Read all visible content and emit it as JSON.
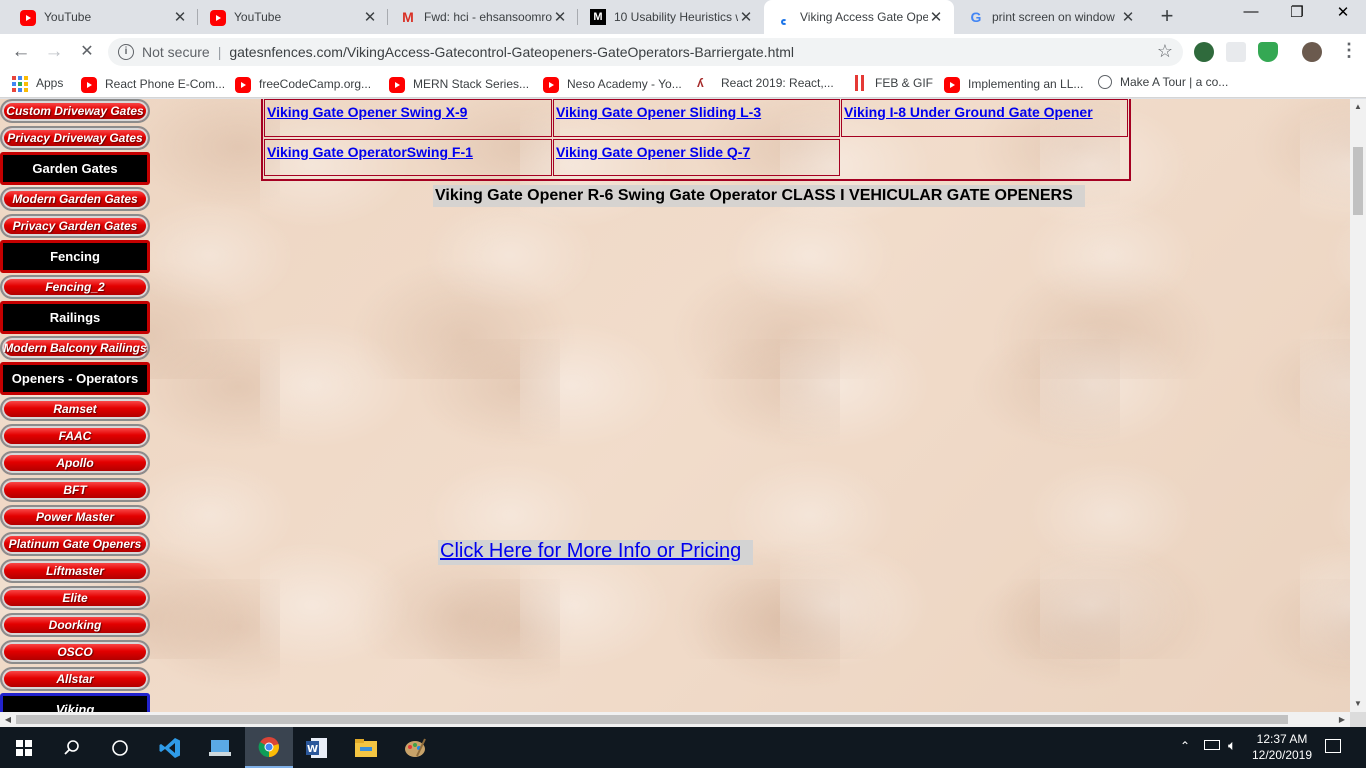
{
  "browser": {
    "tabs": [
      {
        "title": "YouTube",
        "icon": "youtube-icon",
        "active": false
      },
      {
        "title": "YouTube",
        "icon": "youtube-icon",
        "active": false
      },
      {
        "title": "Fwd: hci - ehsansoomro",
        "icon": "gmail-icon",
        "active": false
      },
      {
        "title": "10 Usability Heuristics w",
        "icon": "medium-icon",
        "active": false
      },
      {
        "title": "Viking Access Gate Ope",
        "icon": "loading-spinner-icon",
        "active": true
      },
      {
        "title": "print screen on window",
        "icon": "google-icon",
        "active": false
      }
    ],
    "security_label": "Not secure",
    "url": "gatesnfences.com/VikingAccess-Gatecontrol-Gateopeners-GateOperators-Barriergate.html",
    "window_controls": {
      "minimize": "—",
      "restore": "❐",
      "close": "✕"
    }
  },
  "bookmarks": [
    {
      "label": "Apps",
      "icon": "apps-grid-icon"
    },
    {
      "label": "React Phone E-Com...",
      "icon": "youtube-icon"
    },
    {
      "label": "freeCodeCamp.org...",
      "icon": "youtube-icon"
    },
    {
      "label": "MERN Stack Series...",
      "icon": "youtube-icon"
    },
    {
      "label": "Neso Academy - Yo...",
      "icon": "youtube-icon"
    },
    {
      "label": "React 2019: React,...",
      "icon": "freecodecamp-icon"
    },
    {
      "label": "FEB & GIF",
      "icon": "feb-icon"
    },
    {
      "label": "Implementing an LL...",
      "icon": "youtube-icon"
    },
    {
      "label": "Make A Tour | a co...",
      "icon": "globe-icon"
    }
  ],
  "sidebar": {
    "items": [
      {
        "label": "Custom Driveway Gates",
        "kind": "pill"
      },
      {
        "label": "Privacy Driveway Gates",
        "kind": "pill"
      },
      {
        "label": "Garden Gates",
        "kind": "category"
      },
      {
        "label": "Modern Garden Gates",
        "kind": "pill"
      },
      {
        "label": "Privacy Garden Gates",
        "kind": "pill"
      },
      {
        "label": "Fencing",
        "kind": "category"
      },
      {
        "label": "Fencing_2",
        "kind": "pill"
      },
      {
        "label": "Railings",
        "kind": "category"
      },
      {
        "label": "Modern Balcony Railings",
        "kind": "pill"
      },
      {
        "label": "Openers - Operators",
        "kind": "category"
      },
      {
        "label": "Ramset",
        "kind": "pill"
      },
      {
        "label": "FAAC",
        "kind": "pill"
      },
      {
        "label": "Apollo",
        "kind": "pill"
      },
      {
        "label": "BFT",
        "kind": "pill"
      },
      {
        "label": "Power Master",
        "kind": "pill"
      },
      {
        "label": "Platinum Gate Openers",
        "kind": "pill"
      },
      {
        "label": "Liftmaster",
        "kind": "pill"
      },
      {
        "label": "Elite",
        "kind": "pill"
      },
      {
        "label": "Doorking",
        "kind": "pill"
      },
      {
        "label": "OSCO",
        "kind": "pill"
      },
      {
        "label": "Allstar",
        "kind": "pill"
      },
      {
        "label": "Viking",
        "kind": "category-active"
      }
    ]
  },
  "main": {
    "product_links": [
      "Viking Gate Opener Swing X-9",
      "Viking Gate Opener Sliding L-3",
      "Viking I-8 Under Ground Gate Opener",
      "Viking Gate OperatorSwing F-1",
      "Viking Gate Opener Slide Q-7"
    ],
    "heading": "Viking Gate Opener R-6 Swing Gate Operator CLASS I VEHICULAR GATE OPENERS",
    "more_info_link": "Click Here for More Info or Pricing"
  },
  "taskbar": {
    "apps": [
      "start-icon",
      "search-icon",
      "task-view-icon",
      "vscode-icon",
      "file-transfer-icon",
      "chrome-icon",
      "word-icon",
      "file-explorer-icon",
      "paint-icon"
    ],
    "time": "12:37 AM",
    "date": "12/20/2019"
  },
  "colors": {
    "nav_red": "#e30000",
    "table_border": "#a50021",
    "link_blue": "#0000ee",
    "taskbar": "#101820"
  }
}
